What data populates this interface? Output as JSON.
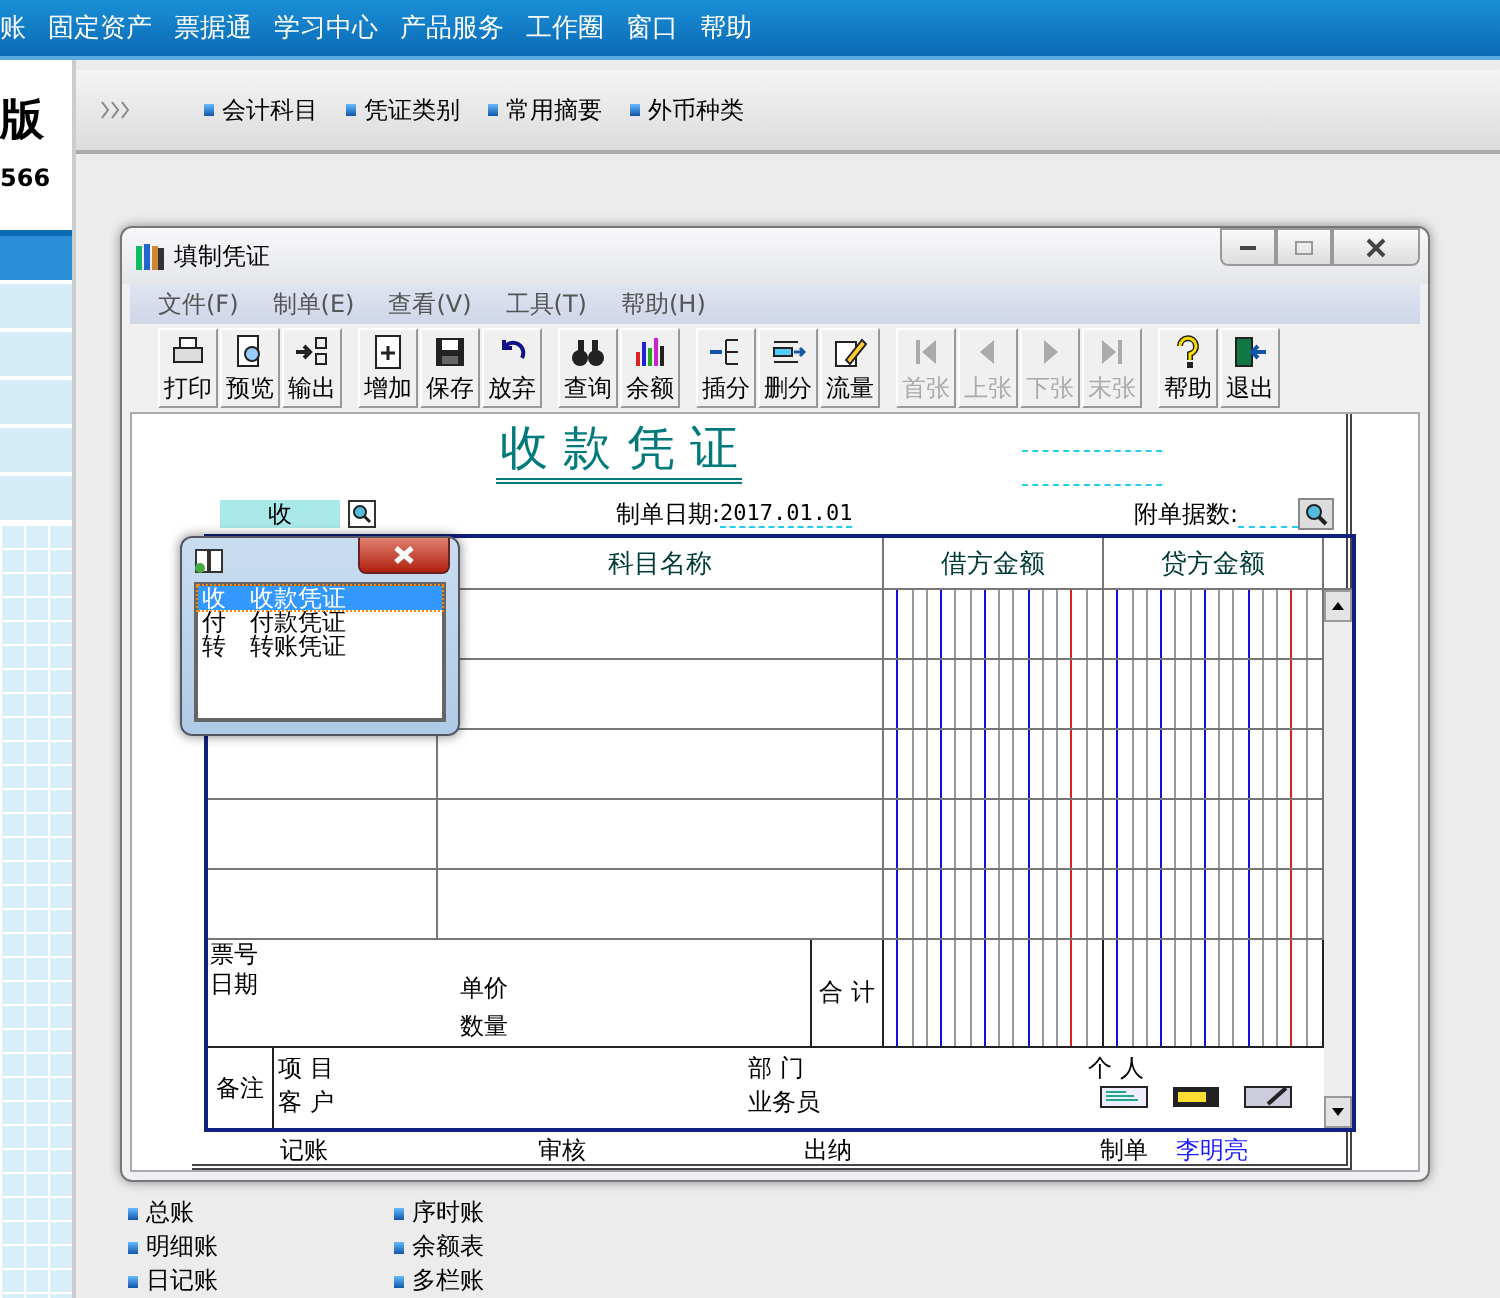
{
  "menu_bar": [
    "账",
    "固定资产",
    "票据通",
    "学习中心",
    "产品服务",
    "工作圈",
    "窗口",
    "帮助"
  ],
  "brand": {
    "edition_fragment": "版",
    "number_fragment": "566"
  },
  "sidebar_rows": [
    {
      "selected": true
    },
    {
      "selected": false
    },
    {
      "selected": false
    },
    {
      "selected": false
    },
    {
      "selected": false
    },
    {
      "selected": false
    }
  ],
  "quick_links": [
    "会计科目",
    "凭证类别",
    "常用摘要",
    "外币种类"
  ],
  "window": {
    "title": "填制凭证",
    "menu": [
      "文件(F)",
      "制单(E)",
      "查看(V)",
      "工具(T)",
      "帮助(H)"
    ],
    "toolbar_groups": [
      [
        {
          "label": "打印",
          "kind": "print",
          "disabled": false
        },
        {
          "label": "预览",
          "kind": "preview",
          "disabled": false
        },
        {
          "label": "输出",
          "kind": "export",
          "disabled": false
        }
      ],
      [
        {
          "label": "增加",
          "kind": "add",
          "disabled": false
        },
        {
          "label": "保存",
          "kind": "save",
          "disabled": false
        },
        {
          "label": "放弃",
          "kind": "undo",
          "disabled": false
        }
      ],
      [
        {
          "label": "查询",
          "kind": "find",
          "disabled": false
        },
        {
          "label": "余额",
          "kind": "balance",
          "disabled": false
        }
      ],
      [
        {
          "label": "插分",
          "kind": "insert",
          "disabled": false
        },
        {
          "label": "删分",
          "kind": "remove",
          "disabled": false
        },
        {
          "label": "流量",
          "kind": "flow",
          "disabled": false
        }
      ],
      [
        {
          "label": "首张",
          "kind": "first",
          "disabled": true
        },
        {
          "label": "上张",
          "kind": "prev",
          "disabled": true
        },
        {
          "label": "下张",
          "kind": "next",
          "disabled": true
        },
        {
          "label": "末张",
          "kind": "last",
          "disabled": true
        }
      ],
      [
        {
          "label": "帮助",
          "kind": "help",
          "disabled": false
        },
        {
          "label": "退出",
          "kind": "exit",
          "disabled": false
        }
      ]
    ]
  },
  "voucher": {
    "title": "收 款 凭 证",
    "type_value": "收",
    "date_label": "制单日期:",
    "date": "2017.01.01",
    "attachments_label": "附单据数:",
    "columns": [
      "科目名称",
      "借方金额",
      "贷方金额"
    ],
    "footer": {
      "ticket_no": "票号",
      "date": "日期",
      "unit_price": "单价",
      "quantity": "数量",
      "total": "合 计",
      "remark": "备注",
      "project": "项 目",
      "customer": "客 户",
      "department": "部 门",
      "salesperson": "业务员",
      "individual": "个 人"
    },
    "signatures": [
      {
        "label": "记账"
      },
      {
        "label": "审核"
      },
      {
        "label": "出纳"
      },
      {
        "label": "制单",
        "value": "李明亮"
      }
    ]
  },
  "type_popup": {
    "items": [
      {
        "code": "收",
        "name": "收款凭证",
        "selected": true
      },
      {
        "code": "付",
        "name": "付款凭证",
        "selected": false
      },
      {
        "code": "转",
        "name": "转账凭证",
        "selected": false
      }
    ]
  },
  "bottom_links": [
    [
      "总账",
      "明细账",
      "日记账"
    ],
    [
      "序时账",
      "余额表",
      "多栏账"
    ]
  ]
}
